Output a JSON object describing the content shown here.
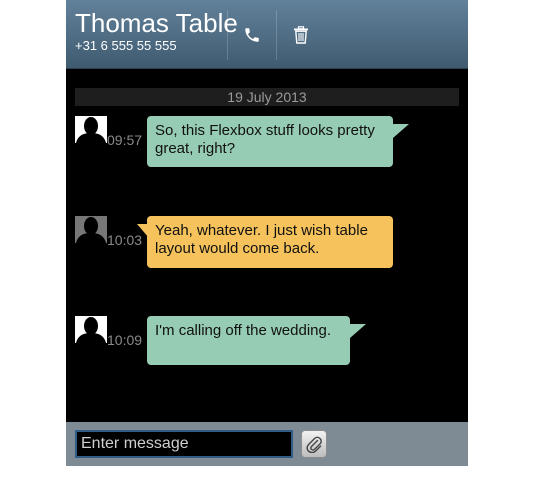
{
  "header": {
    "contact_name": "Thomas Table",
    "contact_number": "+31 6 555 55 555",
    "call_icon": "phone-icon",
    "delete_icon": "trash-icon"
  },
  "conversation": {
    "date": "19 July 2013",
    "messages": [
      {
        "time": "09:57",
        "text": "So, this Flexbox stuff looks pretty great, right?",
        "color": "#96ccb3",
        "avatar_icon": "user-silhouette-icon"
      },
      {
        "time": "10:03",
        "text": "Yeah, whatever. I just wish table layout would come back.",
        "color": "#f5c25b",
        "avatar_icon": "user-silhouette-icon"
      },
      {
        "time": "10:09",
        "text": "I'm calling off the wedding.",
        "color": "#96ccb3",
        "avatar_icon": "user-silhouette-icon"
      }
    ]
  },
  "composer": {
    "placeholder": "Enter message",
    "value": "",
    "attach_icon": "paperclip-icon"
  },
  "colors": {
    "header_top": "#62819a",
    "header_bottom": "#3f5b70",
    "background": "#000000",
    "footer": "#7e8a94"
  }
}
